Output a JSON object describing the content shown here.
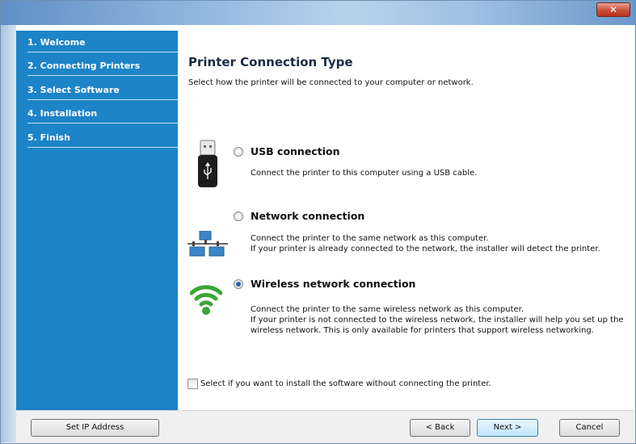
{
  "window": {
    "close_glyph": "✕"
  },
  "sidebar": {
    "items": [
      {
        "label": "1. Welcome"
      },
      {
        "label": "2. Connecting Printers"
      },
      {
        "label": "3. Select Software"
      },
      {
        "label": "4. Installation"
      },
      {
        "label": "5. Finish"
      }
    ]
  },
  "main": {
    "title": "Printer Connection Type",
    "subtitle": "Select how the printer will be connected to your computer or network.",
    "options": [
      {
        "icon": "usb-icon",
        "label": "USB connection",
        "selected": false,
        "description": [
          "Connect the printer to this computer using a USB cable."
        ]
      },
      {
        "icon": "network-icon",
        "label": "Network connection",
        "selected": false,
        "description": [
          "Connect the printer to the same network as this computer.",
          "If your printer is already connected to the network, the installer will detect the printer."
        ]
      },
      {
        "icon": "wireless-icon",
        "label": "Wireless network connection",
        "selected": true,
        "description": [
          "Connect the printer to the same wireless network as this computer.",
          "If your printer is not connected to the wireless network, the installer will help you set up the",
          "wireless network. This is only available for printers that support wireless networking."
        ]
      }
    ],
    "checkbox_label": "Select if you want to install the software without connecting the printer.",
    "checkbox_checked": false
  },
  "footer": {
    "set_ip_label": "Set IP Address",
    "back_label": "< Back",
    "next_label": "Next >",
    "cancel_label": "Cancel"
  },
  "colors": {
    "sidebar": "#1c84c7",
    "accent": "#2a5ea6"
  }
}
